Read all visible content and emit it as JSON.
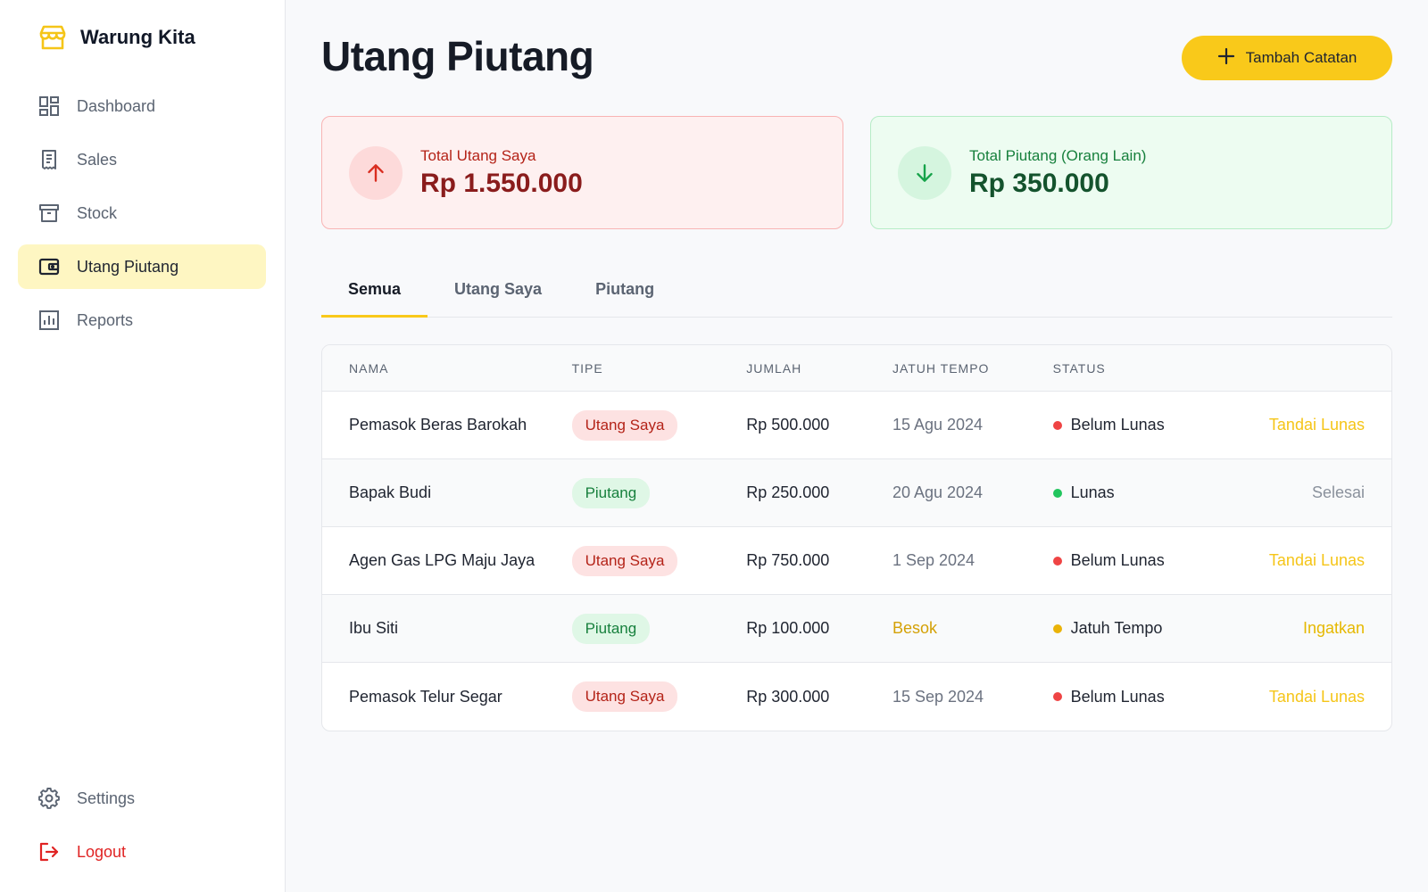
{
  "brand": {
    "name": "Warung Kita",
    "accent": "#F9C91A"
  },
  "sidebar": {
    "items": [
      {
        "label": "Dashboard",
        "icon": "dashboard-icon"
      },
      {
        "label": "Sales",
        "icon": "receipt-icon"
      },
      {
        "label": "Stock",
        "icon": "archive-icon"
      },
      {
        "label": "Utang Piutang",
        "icon": "wallet-icon",
        "active": true
      },
      {
        "label": "Reports",
        "icon": "bar-chart-icon"
      }
    ],
    "bottom": [
      {
        "label": "Settings",
        "icon": "gear-icon"
      },
      {
        "label": "Logout",
        "icon": "logout-icon"
      }
    ]
  },
  "header": {
    "title": "Utang Piutang",
    "add_label": "Tambah Catatan"
  },
  "summary": {
    "utang": {
      "label": "Total Utang Saya",
      "value": "Rp 1.550.000",
      "color": "#B42318"
    },
    "piutang": {
      "label": "Total Piutang (Orang Lain)",
      "value": "Rp 350.000",
      "color": "#17803D"
    }
  },
  "tabs": [
    {
      "label": "Semua",
      "active": true
    },
    {
      "label": "Utang Saya"
    },
    {
      "label": "Piutang"
    }
  ],
  "table": {
    "columns": [
      "NAMA",
      "TIPE",
      "JUMLAH",
      "JATUH TEMPO",
      "STATUS"
    ],
    "rows": [
      {
        "name": "Pemasok Beras Barokah",
        "type": "Utang Saya",
        "amount": "Rp 500.000",
        "due": "15 Agu 2024",
        "status": "Belum Lunas",
        "action": "Tandai Lunas"
      },
      {
        "name": "Bapak Budi",
        "type": "Piutang",
        "amount": "Rp 250.000",
        "due": "20 Agu 2024",
        "status": "Lunas",
        "action": "Selesai"
      },
      {
        "name": "Agen Gas LPG Maju Jaya",
        "type": "Utang Saya",
        "amount": "Rp 750.000",
        "due": "1 Sep 2024",
        "status": "Belum Lunas",
        "action": "Tandai Lunas"
      },
      {
        "name": "Ibu Siti",
        "type": "Piutang",
        "amount": "Rp 100.000",
        "due": "Besok",
        "status": "Jatuh Tempo",
        "action": "Ingatkan"
      },
      {
        "name": "Pemasok Telur Segar",
        "type": "Utang Saya",
        "amount": "Rp 300.000",
        "due": "15 Sep 2024",
        "status": "Belum Lunas",
        "action": "Tandai Lunas"
      }
    ]
  }
}
